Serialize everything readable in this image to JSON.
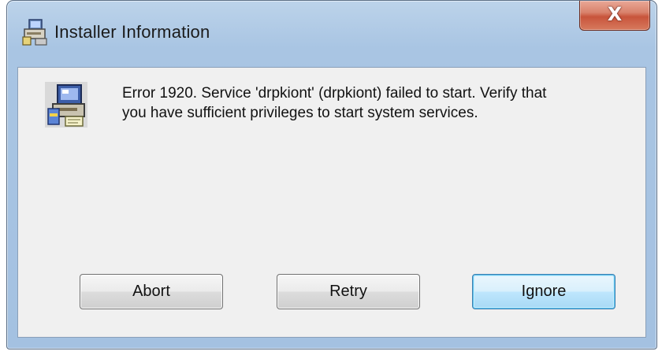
{
  "window": {
    "title": "Installer Information",
    "title_icon": "installer-icon",
    "close_glyph": "X"
  },
  "dialog": {
    "icon": "computer-installer-icon",
    "message": "Error 1920. Service 'drpkiont' (drpkiont) failed to start.  Verify that\nyou have sufficient privileges to start system services."
  },
  "buttons": {
    "abort": "Abort",
    "retry": "Retry",
    "ignore": "Ignore",
    "default": "ignore"
  },
  "colors": {
    "title_bar": "#a9c5e3",
    "close_button": "#c8543b",
    "client_background": "#f0f0f0",
    "default_button_border": "#3c7fb1"
  }
}
